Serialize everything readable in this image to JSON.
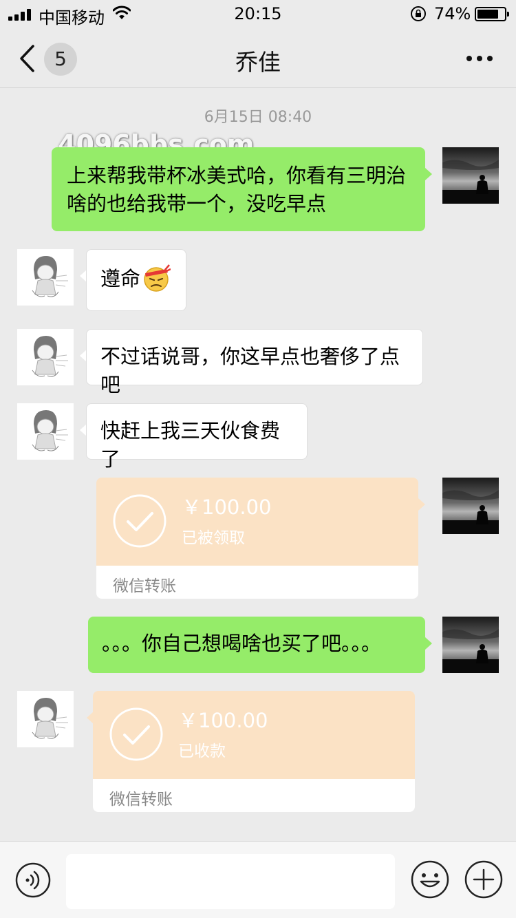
{
  "status_bar": {
    "carrier": "中国移动",
    "time": "20:15",
    "battery_percent": "74%",
    "battery_level": 0.74,
    "icons": [
      "signal-icon",
      "wifi-icon",
      "orientation-lock-icon",
      "battery-icon"
    ]
  },
  "nav": {
    "title": "乔佳",
    "unread_count": "5",
    "icons": [
      "back-chevron-icon",
      "more-icon"
    ]
  },
  "chat": {
    "timestamp": "6月15日 08:40",
    "watermark": "4096bbs.com",
    "messages": [
      {
        "sender": "me",
        "type": "text",
        "text": "上来帮我带杯冰美式哈，你看有三明治啥的也给我带一个，没吃早点"
      },
      {
        "sender": "other",
        "type": "text",
        "text": "遵命",
        "emoji": "determined-face-emoji"
      },
      {
        "sender": "other",
        "type": "text",
        "text": "不过话说哥，你这早点也奢侈了点吧"
      },
      {
        "sender": "other",
        "type": "text",
        "text": "快赶上我三天伙食费了"
      },
      {
        "sender": "me",
        "type": "transfer",
        "amount": "￥100.00",
        "status": "已被领取",
        "label": "微信转账"
      },
      {
        "sender": "me",
        "type": "text",
        "text": "。。。你自己想喝啥也买了吧。。。"
      },
      {
        "sender": "other",
        "type": "transfer",
        "amount": "￥100.00",
        "status": "已收款",
        "label": "微信转账"
      }
    ]
  },
  "input_bar": {
    "placeholder": "",
    "value": "",
    "icons": [
      "voice-icon",
      "emoji-icon",
      "plus-icon"
    ]
  },
  "colors": {
    "background": "#ebebeb",
    "my_bubble": "#95ec69",
    "other_bubble": "#ffffff",
    "transfer_card": "#fbe2c5"
  }
}
